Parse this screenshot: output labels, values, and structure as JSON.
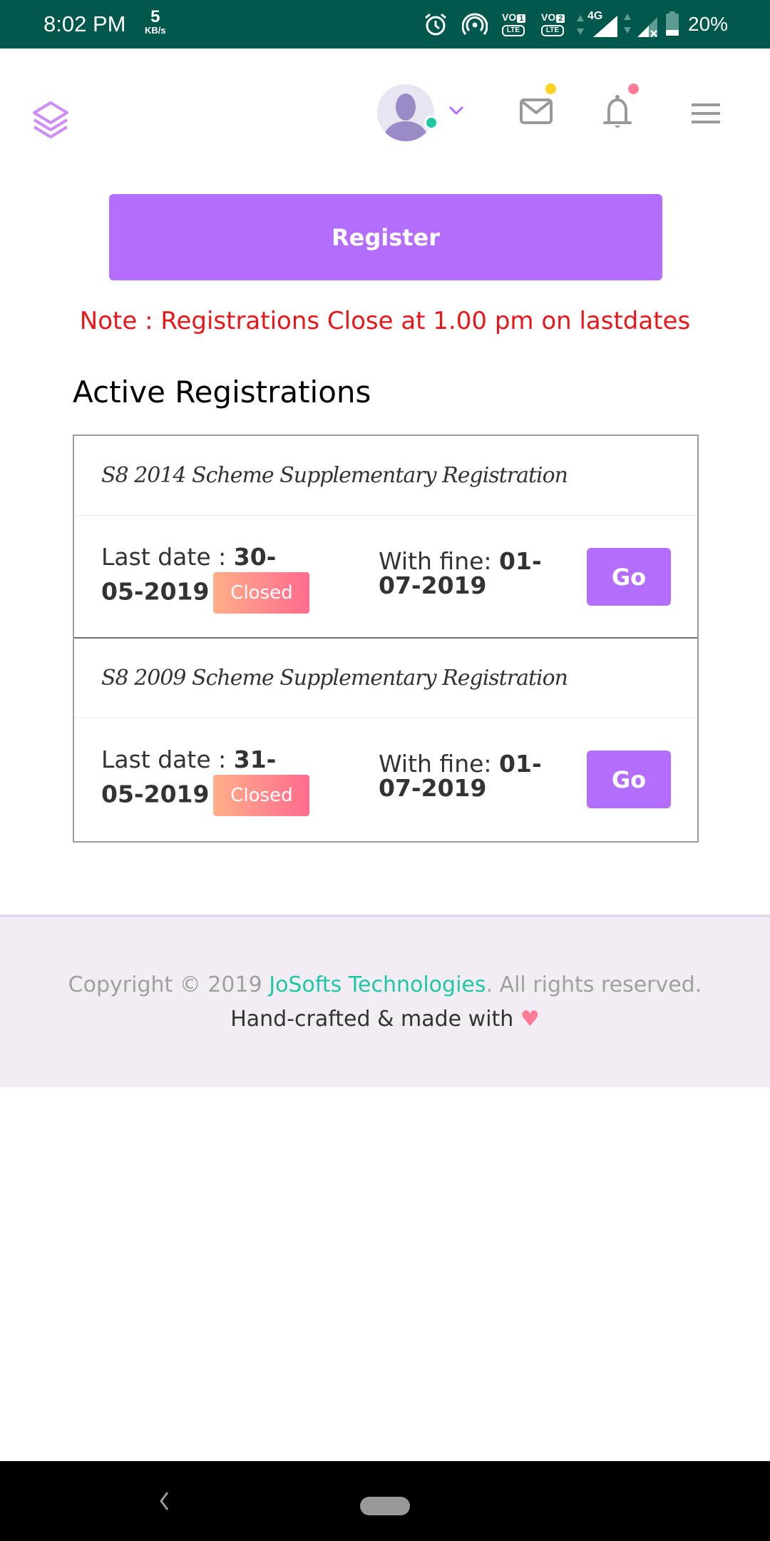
{
  "status_bar": {
    "time": "8:02 PM",
    "net_speed_value": "5",
    "net_speed_unit": "KB/s",
    "icons": [
      "alarm-icon",
      "hotspot-icon",
      "volte-sim1-icon",
      "volte-sim2-icon",
      "signal-4g-icon",
      "signal-no-service-icon",
      "battery-icon"
    ],
    "network_type": "4G",
    "sim1_label": "VO",
    "sim1_num": "1",
    "sim2_label": "VO",
    "sim2_num": "2",
    "lte": "LTE",
    "battery": "20%"
  },
  "header": {
    "logo_icon": "layers-icon",
    "avatar_icon": "user-avatar-icon",
    "icons": [
      "chevron-down-icon",
      "mail-icon",
      "bell-icon",
      "menu-icon"
    ],
    "colors": {
      "accent": "#b46efd",
      "online": "#1ec8a5",
      "mail_badge": "#ffd21f",
      "bell_badge": "#ff7b96"
    }
  },
  "register_button": "Register",
  "note": "Note : Registrations Close at 1.00 pm on lastdates",
  "section_title": "Active Registrations",
  "registrations": [
    {
      "name": "S8 2014 Scheme Supplementary Registration",
      "last_date_label": "Last date : ",
      "last_date": "30-05-2019",
      "status": "Closed",
      "with_fine_label": "With fine: ",
      "with_fine_date": "01-07-2019",
      "action": "Go"
    },
    {
      "name": "S8 2009 Scheme Supplementary Registration",
      "last_date_label": "Last date : ",
      "last_date": "31-05-2019",
      "status": "Closed",
      "with_fine_label": "With fine: ",
      "with_fine_date": "01-07-2019",
      "action": "Go"
    }
  ],
  "footer": {
    "copyright_prefix": "Copyright © 2019 ",
    "brand": "JoSofts Technologies",
    "copyright_suffix": ". All rights reserved.",
    "crafted": "Hand-crafted & made with ",
    "heart": "♥"
  },
  "nav_bar": {
    "icons": [
      "back-icon",
      "home-pill-icon"
    ]
  }
}
